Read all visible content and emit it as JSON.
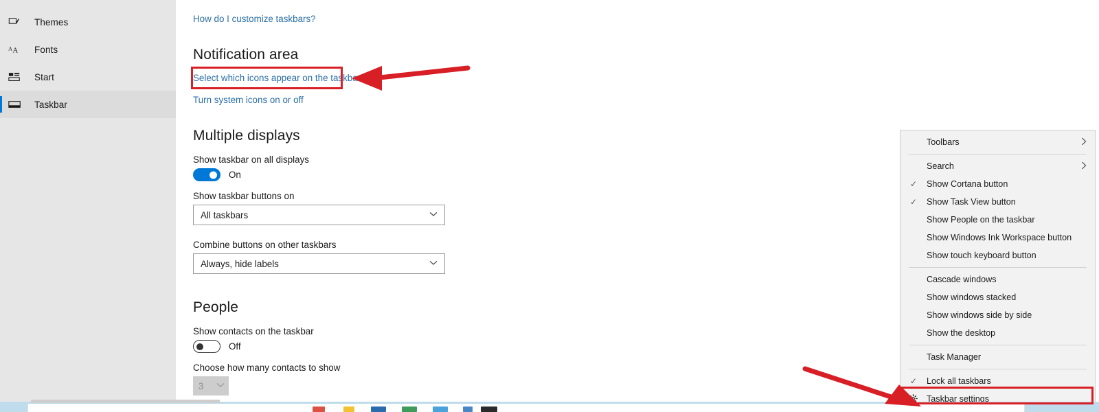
{
  "sidebar": {
    "items": [
      {
        "label": "Themes",
        "icon": "themes-icon",
        "selected": false
      },
      {
        "label": "Fonts",
        "icon": "fonts-icon",
        "selected": false
      },
      {
        "label": "Start",
        "icon": "start-icon",
        "selected": false
      },
      {
        "label": "Taskbar",
        "icon": "taskbar-icon",
        "selected": true
      }
    ]
  },
  "content": {
    "help_link": "How do I customize taskbars?",
    "notification": {
      "heading": "Notification area",
      "link_select_icons": "Select which icons appear on the taskbar",
      "link_system_icons": "Turn system icons on or off"
    },
    "multiple_displays": {
      "heading": "Multiple displays",
      "show_on_all_label": "Show taskbar on all displays",
      "show_on_all_state": "On",
      "buttons_on_label": "Show taskbar buttons on",
      "buttons_on_value": "All taskbars",
      "combine_label": "Combine buttons on other taskbars",
      "combine_value": "Always, hide labels"
    },
    "people": {
      "heading": "People",
      "show_contacts_label": "Show contacts on the taskbar",
      "show_contacts_state": "Off",
      "how_many_label": "Choose how many contacts to show",
      "how_many_value": "3"
    }
  },
  "context_menu": {
    "items": [
      {
        "label": "Toolbars",
        "checked": false,
        "submenu": true,
        "icon": "",
        "sep_after": true
      },
      {
        "label": "Search",
        "checked": false,
        "submenu": true,
        "icon": "",
        "sep_after": false
      },
      {
        "label": "Show Cortana button",
        "checked": true,
        "submenu": false,
        "icon": "",
        "sep_after": false
      },
      {
        "label": "Show Task View button",
        "checked": true,
        "submenu": false,
        "icon": "",
        "sep_after": false
      },
      {
        "label": "Show People on the taskbar",
        "checked": false,
        "submenu": false,
        "icon": "",
        "sep_after": false
      },
      {
        "label": "Show Windows Ink Workspace button",
        "checked": false,
        "submenu": false,
        "icon": "",
        "sep_after": false
      },
      {
        "label": "Show touch keyboard button",
        "checked": false,
        "submenu": false,
        "icon": "",
        "sep_after": true
      },
      {
        "label": "Cascade windows",
        "checked": false,
        "submenu": false,
        "icon": "",
        "sep_after": false
      },
      {
        "label": "Show windows stacked",
        "checked": false,
        "submenu": false,
        "icon": "",
        "sep_after": false
      },
      {
        "label": "Show windows side by side",
        "checked": false,
        "submenu": false,
        "icon": "",
        "sep_after": false
      },
      {
        "label": "Show the desktop",
        "checked": false,
        "submenu": false,
        "icon": "",
        "sep_after": true
      },
      {
        "label": "Task Manager",
        "checked": false,
        "submenu": false,
        "icon": "",
        "sep_after": true
      },
      {
        "label": "Lock all taskbars",
        "checked": true,
        "submenu": false,
        "icon": "",
        "sep_after": false
      },
      {
        "label": "Taskbar settings",
        "checked": false,
        "submenu": false,
        "icon": "gear-icon",
        "sep_after": false
      }
    ]
  },
  "annotations": {
    "accent_color": "#d81f26",
    "highlight_targets": [
      "Select which icons appear on the taskbar",
      "Taskbar settings"
    ]
  },
  "colors": {
    "accent": "#0078d7",
    "link": "#2b6fa8",
    "sidebar_bg": "#e6e6e6",
    "menu_bg": "#f2f2f2",
    "taskbar_bg": "#bfdcec",
    "annotation_red": "#d81f26"
  }
}
